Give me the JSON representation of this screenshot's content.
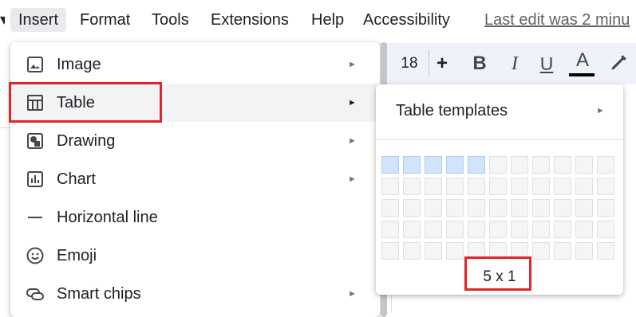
{
  "menubar": {
    "items": [
      {
        "label": "Insert",
        "active": true
      },
      {
        "label": "Format"
      },
      {
        "label": "Tools"
      },
      {
        "label": "Extensions"
      },
      {
        "label": "Help"
      },
      {
        "label": "Accessibility"
      }
    ],
    "last_edit": "Last edit was 2 minu"
  },
  "toolbar": {
    "font_size": "18",
    "plus": "+",
    "bold": "B",
    "italic": "I",
    "underline": "U",
    "text_color": "A",
    "icons": [
      "bold-icon",
      "italic-icon",
      "underline-icon",
      "text-color-icon",
      "highlight-pen-icon"
    ]
  },
  "insert_menu": {
    "items": [
      {
        "label": "Image",
        "icon": "image-icon",
        "submenu": true
      },
      {
        "label": "Table",
        "icon": "table-icon",
        "submenu": true,
        "highlighted": true
      },
      {
        "label": "Drawing",
        "icon": "drawing-icon",
        "submenu": true
      },
      {
        "label": "Chart",
        "icon": "chart-icon",
        "submenu": true
      },
      {
        "label": "Horizontal line",
        "icon": "horizontal-line-icon",
        "submenu": false
      },
      {
        "label": "Emoji",
        "icon": "emoji-icon",
        "submenu": false
      },
      {
        "label": "Smart chips",
        "icon": "smart-chips-icon",
        "submenu": true
      }
    ]
  },
  "table_submenu": {
    "templates_label": "Table templates",
    "grid": {
      "columns": 11,
      "rows": 5,
      "selected_columns": 5,
      "selected_rows": 1
    },
    "grid_size_label": "5 x 1"
  },
  "arrow_glyph": "►",
  "colors": {
    "highlight_row": "#f1f3f4",
    "selected_cell": "#d2e3fc",
    "annotation_red": "#e0242b",
    "toolbar_bg": "#eef2f9"
  }
}
